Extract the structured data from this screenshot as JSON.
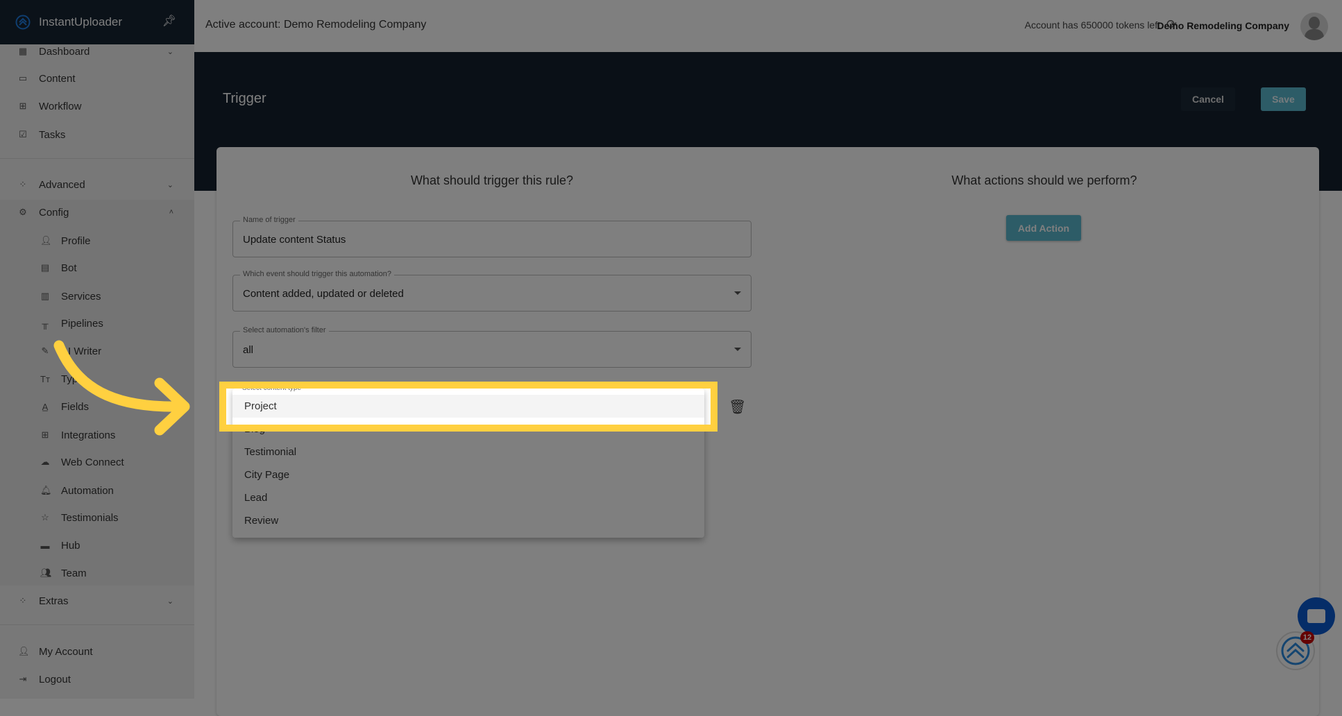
{
  "app": {
    "name": "InstantUploader"
  },
  "topbar": {
    "active_account": "Active account: Demo Remodeling Company",
    "tokens": "Account has 650000 tokens left",
    "company": "Demo Remodeling Company"
  },
  "sidebar": {
    "main": [
      {
        "label": "Dashboard",
        "icon": "dashboard-icon",
        "chevron": true
      },
      {
        "label": "Content",
        "icon": "folder-icon"
      },
      {
        "label": "Workflow",
        "icon": "grid-icon"
      },
      {
        "label": "Tasks",
        "icon": "checkbox-icon"
      }
    ],
    "advanced": {
      "label": "Advanced"
    },
    "config": {
      "label": "Config"
    },
    "config_items": [
      {
        "label": "Profile"
      },
      {
        "label": "Bot"
      },
      {
        "label": "Services"
      },
      {
        "label": "Pipelines"
      },
      {
        "label": "AI Writer"
      },
      {
        "label": "Types"
      },
      {
        "label": "Fields"
      },
      {
        "label": "Integrations"
      },
      {
        "label": "Web Connect"
      },
      {
        "label": "Automation"
      },
      {
        "label": "Testimonials"
      },
      {
        "label": "Hub"
      },
      {
        "label": "Team"
      }
    ],
    "extras": {
      "label": "Extras"
    },
    "my_account": "My Account",
    "logout": "Logout"
  },
  "header": {
    "title": "Trigger",
    "cancel": "Cancel",
    "save": "Save"
  },
  "trigger": {
    "heading": "What should trigger this rule?",
    "name_label": "Name of trigger",
    "name_value": "Update content Status",
    "event_label": "Which event should trigger this automation?",
    "event_value": "Content added, updated or deleted",
    "filter_label": "Select automation's filter",
    "filter_value": "all",
    "content_type_label": "Select content type",
    "content_type_options": [
      "Project",
      "Blog",
      "Testimonial",
      "City Page",
      "Lead",
      "Review"
    ],
    "highlighted_option": "Project"
  },
  "actions": {
    "heading": "What actions should we perform?",
    "add_action": "Add Action"
  },
  "widgets": {
    "badge_count": "12"
  },
  "colors": {
    "accent": "#5bb8cf",
    "highlight": "#ffd040",
    "header": "#15212f"
  }
}
